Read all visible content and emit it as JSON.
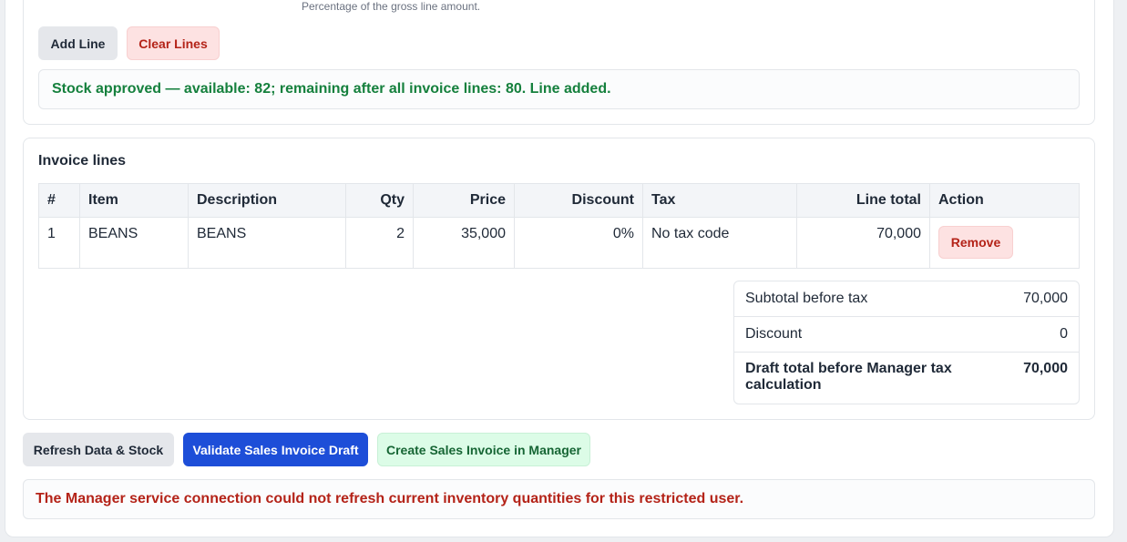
{
  "line_form": {
    "discount_hint": "Percentage of the gross line amount.",
    "add_line_label": "Add Line",
    "clear_lines_label": "Clear Lines",
    "status_message": "Stock approved — available: 82; remaining after all invoice lines: 80. Line added."
  },
  "invoice_lines": {
    "title": "Invoice lines",
    "columns": [
      "#",
      "Item",
      "Description",
      "Qty",
      "Price",
      "Discount",
      "Tax",
      "Line total",
      "Action"
    ],
    "rows": [
      {
        "index": "1",
        "item": "BEANS",
        "description": "BEANS",
        "qty": "2",
        "price": "35,000",
        "discount": "0%",
        "tax": "No tax code",
        "line_total": "70,000",
        "action_label": "Remove"
      }
    ]
  },
  "totals": {
    "subtotal_label": "Subtotal before tax",
    "subtotal_value": "70,000",
    "discount_label": "Discount",
    "discount_value": "0",
    "draft_total_label": "Draft total before Manager tax calculation",
    "draft_total_value": "70,000"
  },
  "actions": {
    "refresh_label": "Refresh Data & Stock",
    "validate_label": "Validate Sales Invoice Draft",
    "create_label": "Create Sales Invoice in Manager"
  },
  "error_message": "The Manager service connection could not refresh current inventory quantities for this restricted user.",
  "colors": {
    "primary": "#1d4ed8",
    "success_text": "#15803d",
    "error_text": "#b42318",
    "danger_bg": "#fde2e2",
    "success_bg": "#dcfce7"
  }
}
